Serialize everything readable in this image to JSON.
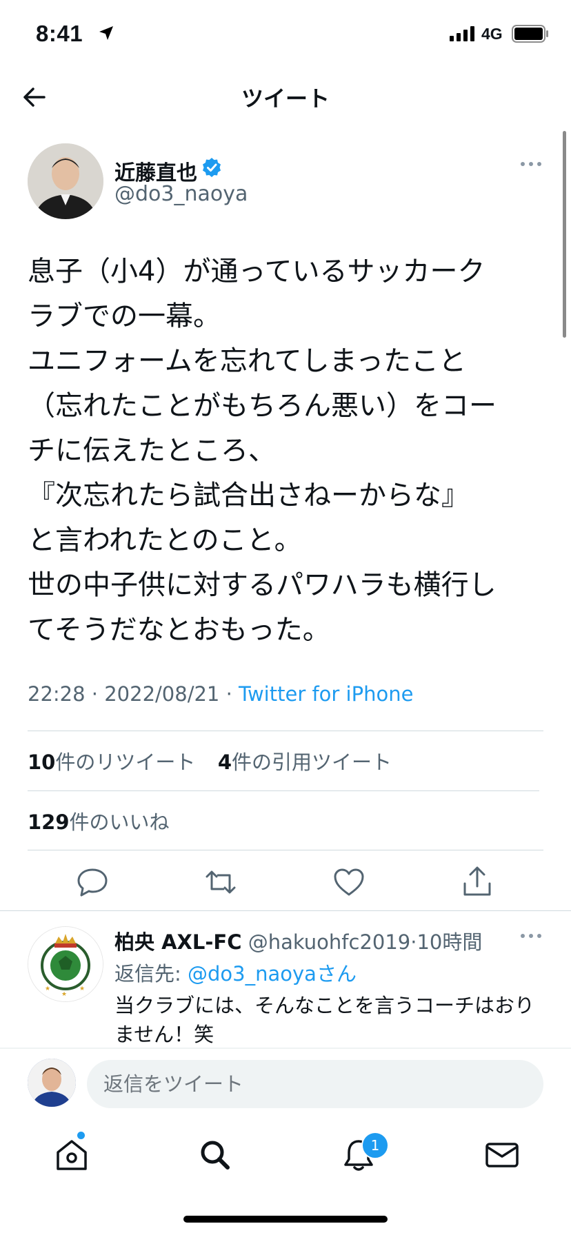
{
  "status_bar": {
    "time": "8:41",
    "network": "4G"
  },
  "header": {
    "title": "ツイート"
  },
  "tweet": {
    "author_name": "近藤直也",
    "author_handle": "@do3_naoya",
    "text": "息子（小4）が通っているサッカーク\nラブでの一幕。\nユニフォームを忘れてしまったこと\n（忘れたことがもちろん悪い）をコー\nチに伝えたところ、\n『次忘れたら試合出さねーからな』\nと言われたとのこと。\n世の中子供に対するパワハラも横行し\nてそうだなとおもった。",
    "time": "22:28",
    "separator": " · ",
    "date": "2022/08/21",
    "source": "Twitter for iPhone",
    "retweets_count": "10",
    "retweets_label": "件のリツイート",
    "quotes_count": "4",
    "quotes_label": "件の引用ツイート",
    "likes_count": "129",
    "likes_label": "件のいいね"
  },
  "reply": {
    "name": "柏央 AXL-FC",
    "handle": "@hakuohfc2019",
    "time": "10時間",
    "reply_to_label": "返信先: ",
    "reply_to_handle": "@do3_naoya",
    "reply_to_suffix": "さん",
    "text": "当クラブには、そんなことを言うコーチはおりません！笑"
  },
  "composer": {
    "placeholder": "返信をツイート"
  },
  "tabbar": {
    "notifications_badge": "1"
  },
  "colors": {
    "accent": "#1d9bf0",
    "secondary_text": "#536471",
    "primary_text": "#0f1419"
  }
}
